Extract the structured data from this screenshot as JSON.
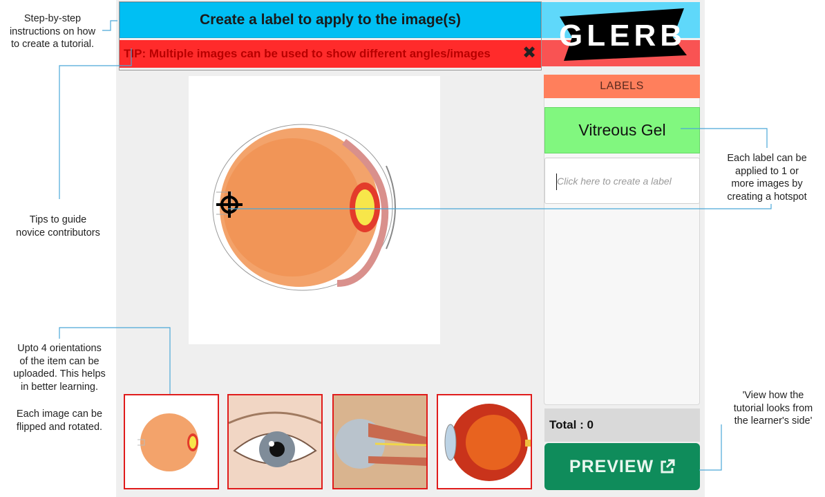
{
  "header": {
    "instruction": "Create a label to apply to the image(s)",
    "tip": "TIP: Multiple images can be used to show different angles/images"
  },
  "brand": {
    "logo_text": "GLERB"
  },
  "labels_panel": {
    "header": "LABELS",
    "items": [
      {
        "label": "Vitreous Gel"
      }
    ],
    "input_placeholder": "Click here to create a label",
    "total": "Total : 0"
  },
  "preview": {
    "label": "PREVIEW"
  },
  "annotations": {
    "step_by_step": [
      "Step-by-step",
      "instructions on how",
      "to create a tutorial."
    ],
    "tips": [
      "Tips to guide",
      "novice contributors"
    ],
    "orientations": [
      "Upto 4 orientations",
      "of the item can be",
      "uploaded. This helps",
      "in better learning."
    ],
    "flip": [
      "Each image can be",
      "flipped and rotated."
    ],
    "label_applied": [
      "Each label can be",
      "applied to 1 or",
      "more images by",
      "creating a hotspot"
    ],
    "view": [
      "'View how the",
      "tutorial looks from",
      "the learner's side'"
    ]
  },
  "colors": {
    "accent_cyan": "#00bff3",
    "tip_red": "#ff2b2b",
    "label_green": "#81f77f",
    "labels_header": "#ff7f5c",
    "preview_green": "#0f8c5b",
    "thumb_border": "#e01b1b",
    "leader_line": "#4aa8d8"
  },
  "icons": {
    "tip_close": "close-icon",
    "preview": "external-link-icon",
    "hotspot": "crosshair-icon"
  }
}
